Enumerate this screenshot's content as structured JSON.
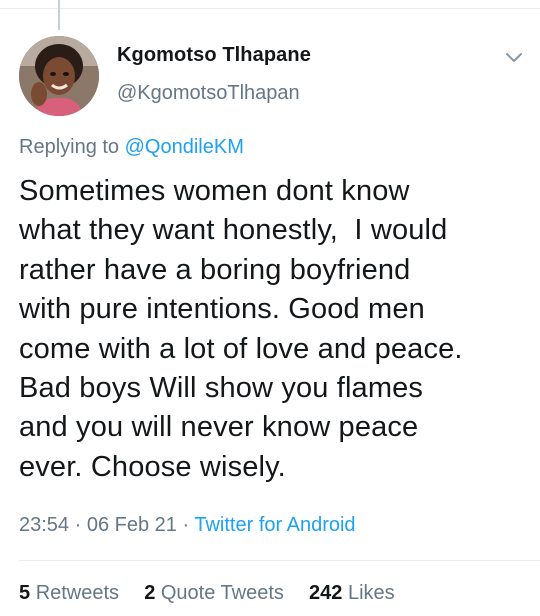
{
  "author": {
    "name": "Kgomotso Tlhapane",
    "handle": "@KgomotsoTlhapan"
  },
  "reply": {
    "prefix": "Replying to",
    "mention": "@QondileKM"
  },
  "tweet": {
    "lines": [
      "Sometimes women dont know",
      "what they want honestly,  I would",
      "rather have a boring boyfriend",
      "with pure intentions. Good men",
      "come with a lot of love and peace.",
      "Bad boys Will show you flames",
      "and you will never know peace",
      "ever. Choose wisely."
    ]
  },
  "meta": {
    "time": "23:54",
    "sep1": "·",
    "date": "06 Feb 21",
    "sep2": "·",
    "source": "Twitter for Android"
  },
  "stats": {
    "retweets_count": "5",
    "retweets_label": "Retweets",
    "quotes_count": "2",
    "quotes_label": "Quote Tweets",
    "likes_count": "242",
    "likes_label": "Likes"
  },
  "icons": {
    "menu": "chevron-down-icon"
  },
  "colors": {
    "text": "#14171a",
    "secondary": "#657786",
    "link": "#1da1f2",
    "divider": "#e6ecf0"
  }
}
